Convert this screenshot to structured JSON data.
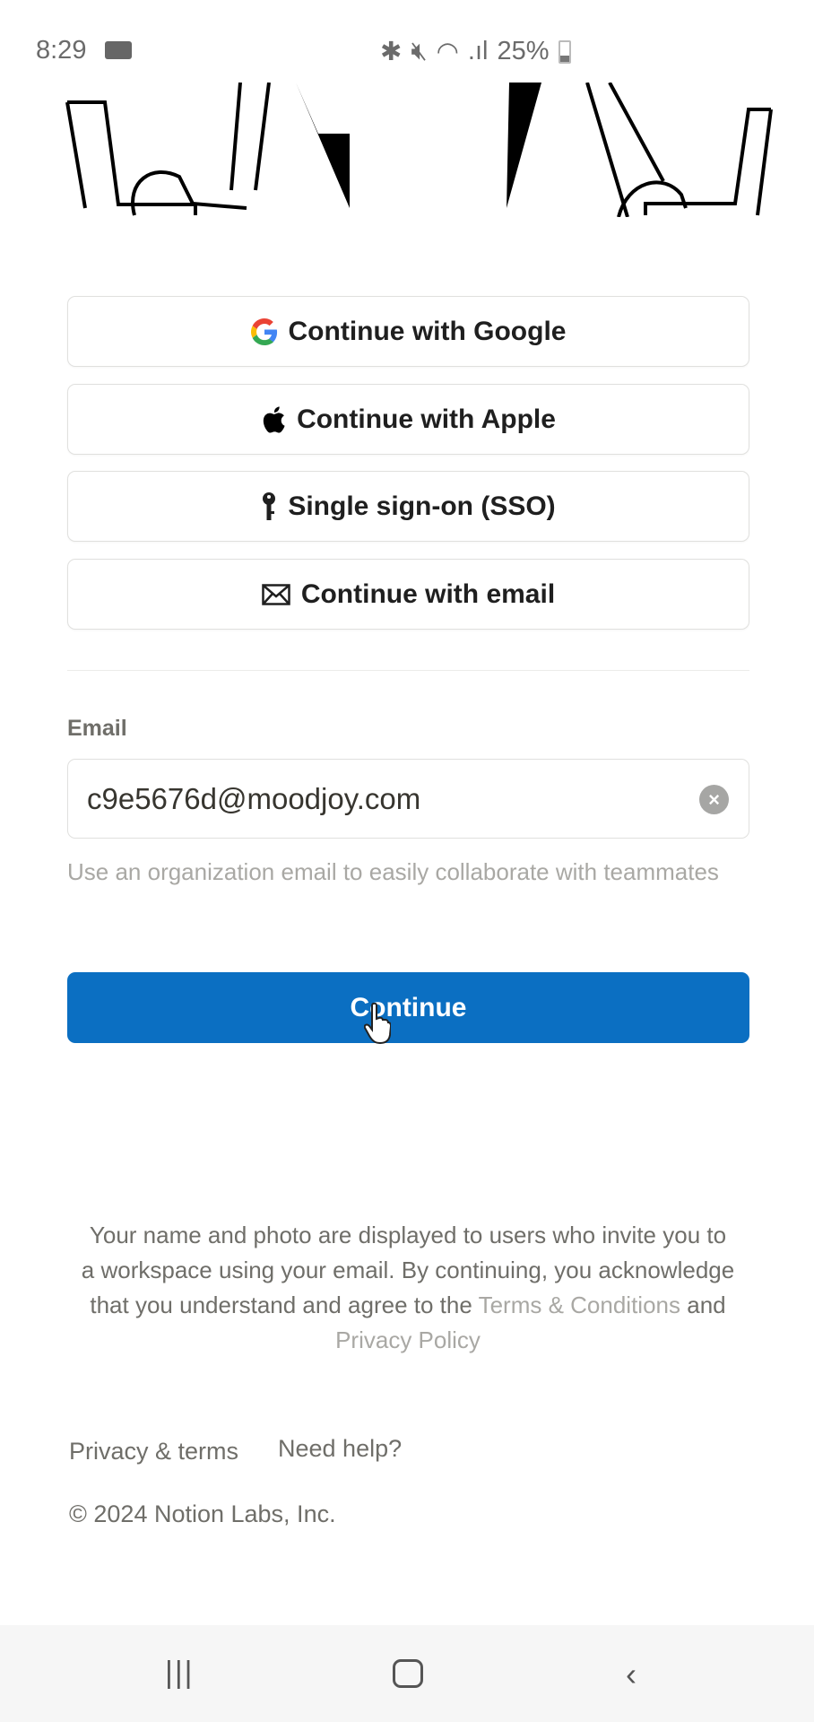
{
  "status_bar": {
    "time": "8:29",
    "battery": "25%",
    "icons": [
      "video-record-icon",
      "bluetooth-icon",
      "mute-icon",
      "wifi-icon",
      "signal-icon",
      "battery-icon"
    ]
  },
  "auth_buttons": [
    {
      "label": "Continue with Google",
      "icon": "google-icon"
    },
    {
      "label": "Continue with Apple",
      "icon": "apple-icon"
    },
    {
      "label": "Single sign-on (SSO)",
      "icon": "key-icon"
    },
    {
      "label": "Continue with email",
      "icon": "mail-icon"
    }
  ],
  "email": {
    "label": "Email",
    "value": "c9e5676d@moodjoy.com",
    "helper": "Use an organization email to easily collaborate with teammates"
  },
  "continue_label": "Continue",
  "legal": {
    "text": "Your name and photo are displayed to users who invite you to a workspace using your email. By continuing, you acknowledge that you understand and agree to the",
    "terms": "Terms & Conditions",
    "and": "and",
    "privacy": "Privacy Policy"
  },
  "footer": {
    "privacy_terms": "Privacy & terms",
    "help": "Need help?",
    "copyright": "© 2024 Notion Labs, Inc."
  },
  "colors": {
    "primary": "#0b6fc2"
  }
}
